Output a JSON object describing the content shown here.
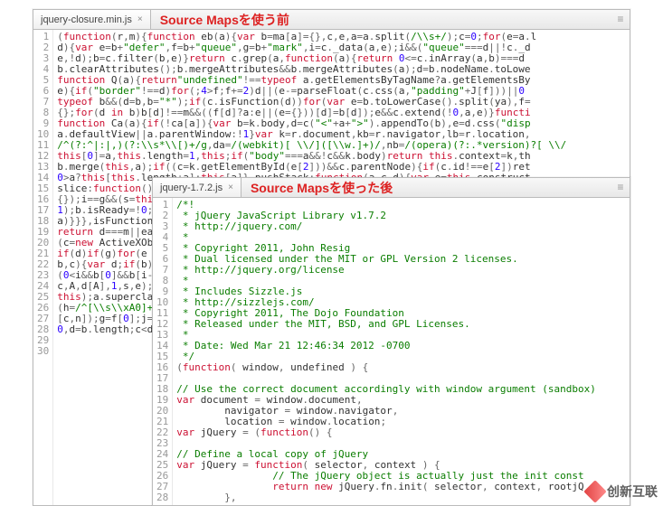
{
  "back": {
    "tab": {
      "filename": "jquery-closure.min.js",
      "close_glyph": "×"
    },
    "tab_note": "Source Mapsを使う前",
    "scroll_glyph": "≡",
    "gutter_start": 1,
    "gutter_count": 30,
    "lines_html": [
      "<span class='op'>(</span><span class='kw'>function</span><span class='op'>(</span>r<span class='op'>,</span>m<span class='op'>){</span><span class='kw'>function</span> eb<span class='op'>(</span>a<span class='op'>){</span><span class='kw'>var</span> b<span class='op'>=</span>ma<span class='op'>[</span>a<span class='op'>]={},</span>c<span class='op'>,</span>e<span class='op'>,</span>a<span class='op'>=</span>a<span class='op'>.</span>split<span class='op'>(</span><span class='str'>/\\\\s+/</span><span class='op'>);</span>c<span class='op'>=</span><span class='num'>0</span><span class='op'>;</span><span class='kw'>for</span><span class='op'>(</span>e<span class='op'>=</span>a<span class='op'>.</span>l",
      "d<span class='op'>){</span><span class='kw'>var</span> e<span class='op'>=</span>b<span class='op'>+</span><span class='str'>\"defer\"</span><span class='op'>,</span>f<span class='op'>=</span>b<span class='op'>+</span><span class='str'>\"queue\"</span><span class='op'>,</span>g<span class='op'>=</span>b<span class='op'>+</span><span class='str'>\"mark\"</span><span class='op'>,</span>i<span class='op'>=</span>c<span class='op'>.</span>_data<span class='op'>(</span>a<span class='op'>,</span>e<span class='op'>);</span>i<span class='op'>&amp;&amp;(</span><span class='str'>\"queue\"</span><span class='op'>===</span>d<span class='op'>||!</span>c<span class='op'>.</span>_d",
      "e<span class='op'>,!</span>d<span class='op'>);</span>b<span class='op'>=</span>c<span class='op'>.</span>filter<span class='op'>(</span>b<span class='op'>,</span>e<span class='op'>)}</span><span class='kw'>return</span> c<span class='op'>.</span>grep<span class='op'>(</span>a<span class='op'>,</span><span class='kw'>function</span><span class='op'>(</span>a<span class='op'>){</span><span class='kw'>return</span> <span class='num'>0</span><span class='op'>&lt;=</span>c<span class='op'>.</span>inArray<span class='op'>(</span>a<span class='op'>,</span>b<span class='op'>)===</span>d",
      "b<span class='op'>.</span>clearAttributes<span class='op'>();</span>b<span class='op'>.</span>mergeAttributes<span class='op'>&amp;&amp;</span>b<span class='op'>.</span>mergeAttributes<span class='op'>(</span>a<span class='op'>);</span>d<span class='op'>=</span>b<span class='op'>.</span>nodeName<span class='op'>.</span>toLowe",
      "<span class='kw'>function</span> Q<span class='op'>(</span>a<span class='op'>){</span><span class='kw'>return</span><span class='str'>\"undefined\"</span><span class='op'>!==</span><span class='kw'>typeof</span> a<span class='op'>.</span>getElementsByTagName<span class='op'>?</span>a<span class='op'>.</span>getElementsBy",
      "e<span class='op'>){</span><span class='kw'>if</span><span class='op'>(</span><span class='str'>\"border\"</span><span class='op'>!==</span>d<span class='op'>)</span><span class='kw'>for</span><span class='op'>(;</span><span class='num'>4</span><span class='op'>&gt;</span>f<span class='op'>;</span>f<span class='op'>+=</span><span class='num'>2</span><span class='op'>)</span>d<span class='op'>||(</span>e<span class='op'>-=</span>parseFloat<span class='op'>(</span>c<span class='op'>.</span>css<span class='op'>(</span>a<span class='op'>,</span><span class='str'>\"padding\"</span><span class='op'>+</span>J<span class='op'>[</span>f<span class='op'>]))||</span><span class='num'>0</span>",
      "<span class='kw'>typeof</span> b<span class='op'>&amp;&amp;(</span>d<span class='op'>=</span>b<span class='op'>,</span>b<span class='op'>=</span><span class='str'>\"*\"</span><span class='op'>);</span><span class='kw'>if</span><span class='op'>(</span>c<span class='op'>.</span>isFunction<span class='op'>(</span>d<span class='op'>))</span><span class='kw'>for</span><span class='op'>(</span><span class='kw'>var</span> e<span class='op'>=</span>b<span class='op'>.</span>toLowerCase<span class='op'>().</span>split<span class='op'>(</span>ya<span class='op'>),</span>f<span class='op'>=</span>",
      "<span class='op'>{};</span><span class='kw'>for</span><span class='op'>(</span>d <span class='kw'>in</span> b<span class='op'>)</span>b<span class='op'>[</span>d<span class='op'>]!==</span>m<span class='op'>&amp;&amp;((</span>f<span class='op'>[</span>d<span class='op'>]?</span>a<span class='op'>:</span>e<span class='op'>||(</span>e<span class='op'>={}))[</span>d<span class='op'>]=</span>b<span class='op'>[</span>d<span class='op'>]);</span>e<span class='op'>&amp;&amp;</span>c<span class='op'>.</span>extend<span class='op'>(!</span><span class='num'>0</span><span class='op'>,</span>a<span class='op'>,</span>e<span class='op'>)}</span><span class='kw'>functi</span>",
      "<span class='kw'>function</span> Ca<span class='op'>(</span>a<span class='op'>){</span><span class='kw'>if</span><span class='op'>(!</span>ca<span class='op'>[</span>a<span class='op'>]){</span><span class='kw'>var</span> b<span class='op'>=</span>k<span class='op'>.</span>body<span class='op'>,</span>d<span class='op'>=</span>c<span class='op'>(</span><span class='str'>\"&lt;\"</span><span class='op'>+</span>a<span class='op'>+</span><span class='str'>\"&gt;\"</span><span class='op'>).</span>appendTo<span class='op'>(</span>b<span class='op'>),</span>e<span class='op'>=</span>d<span class='op'>.</span>css<span class='op'>(</span><span class='str'>\"disp</span>",
      "a<span class='op'>.</span>defaultView<span class='op'>||</span>a<span class='op'>.</span>parentWindow<span class='op'>:!</span><span class='num'>1</span><span class='op'>}</span><span class='kw'>var</span> k<span class='op'>=</span>r<span class='op'>.</span>document<span class='op'>,</span>kb<span class='op'>=</span>r<span class='op'>.</span>navigator<span class='op'>,</span>lb<span class='op'>=</span>r<span class='op'>.</span>location<span class='op'>,</span>",
      "<span class='str'>/^(?:^|:|,)(?:\\\\s*\\\\[)+/g</span><span class='op'>,</span>da<span class='op'>=</span><span class='str'>/(webkit)[ \\\\/]([\\\\w.]+)/</span><span class='op'>,</span>nb<span class='op'>=</span><span class='str'>/(opera)(?:.*version)?[ \\\\/</span>",
      "<span class='kw'>this</span><span class='op'>[</span><span class='num'>0</span><span class='op'>]=</span>a<span class='op'>,</span><span class='kw'>this</span><span class='op'>.</span>length<span class='op'>=</span><span class='num'>1</span><span class='op'>,</span><span class='kw'>this</span><span class='op'>;</span><span class='kw'>if</span><span class='op'>(</span><span class='str'>\"body\"</span><span class='op'>===</span>a<span class='op'>&amp;&amp;!</span>c<span class='op'>&amp;&amp;</span>k<span class='op'>.</span>body<span class='op'>)</span><span class='kw'>return</span> <span class='kw'>this</span><span class='op'>.</span>context<span class='op'>=</span>k<span class='op'>,</span>th",
      "b<span class='op'>.</span>merge<span class='op'>(</span><span class='kw'>this</span><span class='op'>,</span>a<span class='op'>);</span><span class='kw'>if</span><span class='op'>((</span>c<span class='op'>=</span>k<span class='op'>.</span>getElementById<span class='op'>(</span>e<span class='op'>[</span><span class='num'>2</span><span class='op'>]))&amp;&amp;</span>c<span class='op'>.</span>parentNode<span class='op'>){</span><span class='kw'>if</span><span class='op'>(</span>c<span class='op'>.</span>id<span class='op'>!==</span>e<span class='op'>[</span><span class='num'>2</span><span class='op'>])</span>ret",
      "<span class='num'>0</span><span class='op'>&gt;</span>a<span class='op'>?</span><span class='kw'>this</span><span class='op'>[</span><span class='kw'>this</span><span class='op'>.</span>length<span class='op'>+</span>a<span class='op'>]:</span><span class='kw'>this</span><span class='op'>[</span>a<span class='op'>]},</span>pushStack<span class='op'>:</span><span class='kw'>function</span><span class='op'>(</span>a<span class='op'>,</span>c<span class='op'>,</span>d<span class='op'>){</span><span class='kw'>var</span> e<span class='op'>=</span><span class='kw'>this</span><span class='op'>.</span>construct",
      "slice<span class='op'>:</span><span class='kw'>function</span><span class='op'>(){</span>r",
      "<span class='op'>{});</span>i<span class='op'>==</span>g<span class='op'>&amp;&amp;(</span>s<span class='op'>=</span><span class='kw'>this</span>",
      "<span class='num'>1</span><span class='op'>);</span>b<span class='op'>.</span>isReady<span class='op'>=!</span><span class='num'>0</span><span class='op'>;!</span><span class='num'>0</span>",
      "a<span class='op'>)}}},</span>isFunction<span class='op'>:</span>",
      "<span class='kw'>return</span> d<span class='op'>===</span>m<span class='op'>||</span>ea<span class='op'>.</span>c",
      "<span class='op'>(</span>c<span class='op'>=</span><span class='kw'>new</span> ActiveXObje",
      "<span class='kw'>if</span><span class='op'>(</span>d<span class='op'>)</span><span class='kw'>if</span><span class='op'>(</span>g<span class='op'>)</span><span class='kw'>for</span><span class='op'>(</span>e <span class='kw'>in</span>",
      "b<span class='op'>,</span>c<span class='op'>){</span><span class='kw'>var</span> d<span class='op'>;</span><span class='kw'>if</span><span class='op'>(</span>b<span class='op'>){</span>i",
      "<span class='op'>(</span><span class='num'>0</span><span class='op'>&lt;</span>i<span class='op'>&amp;&amp;</span>b<span class='op'>[</span><span class='num'>0</span><span class='op'>]&amp;&amp;</span>b<span class='op'>[</span>i<span class='op'>-</span><span class='num'>1</span><span class='op'>]</span>",
      "c<span class='op'>,</span>A<span class='op'>,</span>d<span class='op'>[</span>A<span class='op'>],</span><span class='num'>1</span><span class='op'>,</span>s<span class='op'>,</span>e<span class='op'>);</span>f<span class='op'>=</span>",
      "<span class='kw'>this</span><span class='op'>);</span>a<span class='op'>.</span>superclass",
      "<span class='op'>(</span>h<span class='op'>=</span><span class='str'>/^[\\\\s\\\\xA0]+/</span><span class='op'>,</span>j",
      "<span class='op'>[</span>c<span class='op'>,</span>n<span class='op'>]);</span>g<span class='op'>=</span>f<span class='op'>[</span><span class='num'>0</span><span class='op'>];</span>j<span class='op'>=!</span><span class='num'>1</span><span class='op'>;</span>i",
      "<span class='num'>0</span><span class='op'>,</span>d<span class='op'>=</span>b<span class='op'>.</span>length<span class='op'>;</span>c<span class='op'>&lt;</span>d<span class='op'>;</span>c",
      "",
      ""
    ]
  },
  "front": {
    "tab": {
      "filename": "jquery-1.7.2.js",
      "close_glyph": "×"
    },
    "tab_note": "Source Mapsを使った後",
    "scroll_glyph": "≡",
    "gutter_start": 1,
    "gutter_count": 28,
    "lines_html": [
      "<span class='cm'>/*!</span>",
      "<span class='cm'> * jQuery JavaScript Library v1.7.2</span>",
      "<span class='cm'> * http://jquery.com/</span>",
      "<span class='cm'> *</span>",
      "<span class='cm'> * Copyright 2011, John Resig</span>",
      "<span class='cm'> * Dual licensed under the MIT or GPL Version 2 licenses.</span>",
      "<span class='cm'> * http://jquery.org/license</span>",
      "<span class='cm'> *</span>",
      "<span class='cm'> * Includes Sizzle.js</span>",
      "<span class='cm'> * http://sizzlejs.com/</span>",
      "<span class='cm'> * Copyright 2011, The Dojo Foundation</span>",
      "<span class='cm'> * Released under the MIT, BSD, and GPL Licenses.</span>",
      "<span class='cm'> *</span>",
      "<span class='cm'> * Date: Wed Mar 21 12:46:34 2012 -0700</span>",
      "<span class='cm'> */</span>",
      "<span class='op'>(</span><span class='kw'>function</span><span class='op'>(</span> window<span class='op'>,</span> undefined <span class='op'>) {</span>",
      "",
      "<span class='cm'>// Use the correct document accordingly with window argument (sandbox)</span>",
      "<span class='kw'>var</span> document <span class='op'>=</span> window<span class='op'>.</span>document<span class='op'>,</span>",
      "        navigator <span class='op'>=</span> window<span class='op'>.</span>navigator<span class='op'>,</span>",
      "        location <span class='op'>=</span> window<span class='op'>.</span>location<span class='op'>;</span>",
      "<span class='kw'>var</span> jQuery <span class='op'>= (</span><span class='kw'>function</span><span class='op'>() {</span>",
      "",
      "<span class='cm'>// Define a local copy of jQuery</span>",
      "<span class='kw'>var</span> jQuery <span class='op'>=</span> <span class='kw'>function</span><span class='op'>(</span> selector<span class='op'>,</span> context <span class='op'>) {</span>",
      "                <span class='cm'>// The jQuery object is actually just the init const</span>",
      "                <span class='kw'>return new</span> jQuery<span class='op'>.</span>fn<span class='op'>.</span>init<span class='op'>(</span> selector<span class='op'>,</span> context<span class='op'>,</span> rootjQ",
      "        <span class='op'>},</span>"
    ]
  },
  "watermark": {
    "text": "创新互联"
  }
}
